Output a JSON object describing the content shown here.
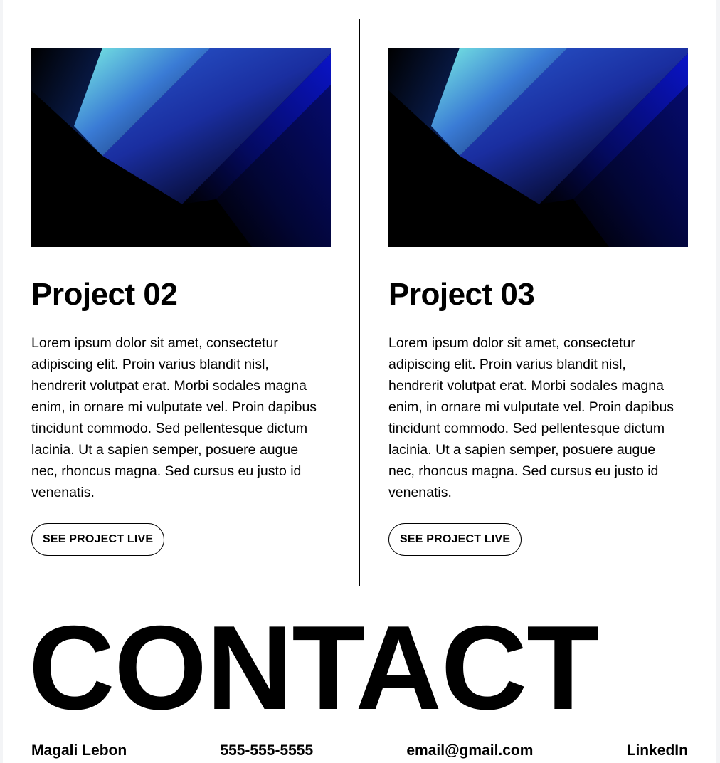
{
  "projects": [
    {
      "title": "Project 02",
      "description": "Lorem ipsum dolor sit amet, consectetur adipiscing elit. Proin varius blandit nisl, hendrerit volutpat erat. Morbi sodales magna enim, in ornare mi vulputate vel. Proin dapibus tincidunt commodo. Sed pellentesque dictum lacinia. Ut a sapien semper, posuere augue nec, rhoncus magna. Sed cursus eu justo id venenatis.",
      "button_label": "SEE PROJECT LIVE",
      "image": "blue-gradient-abstract"
    },
    {
      "title": "Project 03",
      "description": "Lorem ipsum dolor sit amet, consectetur adipiscing elit. Proin varius blandit nisl, hendrerit volutpat erat. Morbi sodales magna enim, in ornare mi vulputate vel. Proin dapibus tincidunt commodo. Sed pellentesque dictum lacinia. Ut a sapien semper, posuere augue nec, rhoncus magna. Sed cursus eu justo id venenatis.",
      "button_label": "SEE PROJECT LIVE",
      "image": "blue-gradient-abstract"
    }
  ],
  "contact": {
    "heading": "CONTACT",
    "name": "Magali Lebon",
    "phone": "555-555-5555",
    "email": "email@gmail.com",
    "linkedin": "LinkedIn"
  },
  "colors": {
    "background": "#ffffff",
    "text": "#000000",
    "gradient_light": "#7cf2e3",
    "gradient_mid": "#3a7bd5",
    "gradient_deep": "#0a14c8"
  }
}
